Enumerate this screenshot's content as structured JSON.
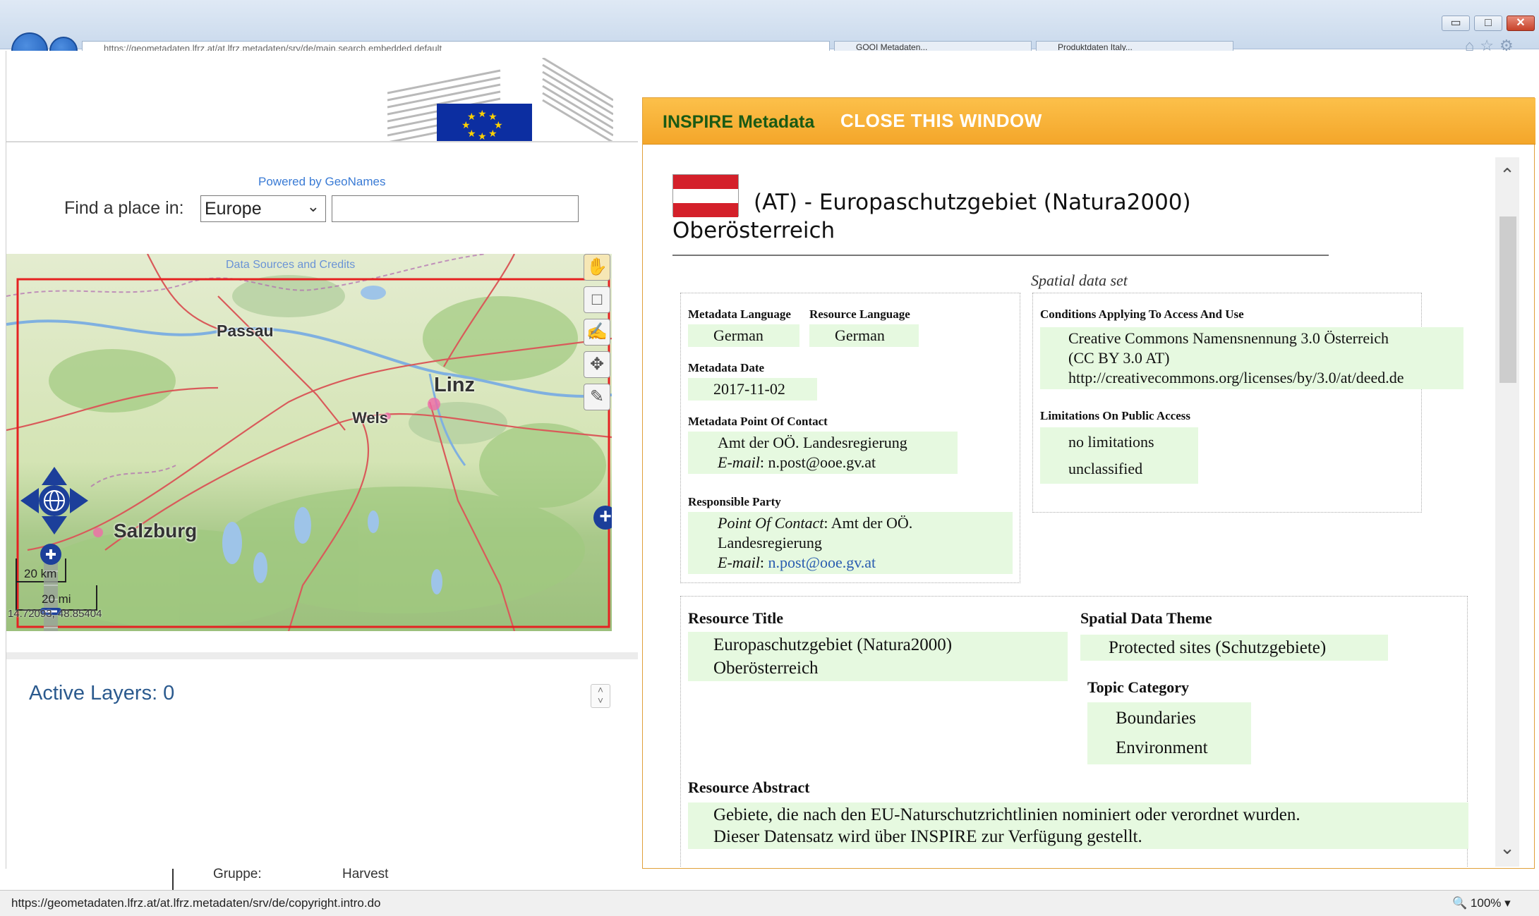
{
  "browser": {
    "back_icon": "arrow-left-icon",
    "forward_icon": "arrow-right-icon",
    "address": "https://geometadaten.lfrz.at/at.lfrz.metadaten/srv/de/main.search.embedded.default",
    "tabs": [
      "GOOI Metadaten...",
      "Produktdaten Italy..."
    ],
    "window_controls": {
      "minimize": "▭",
      "maximize": "□",
      "close": "✕"
    }
  },
  "left_panel": {
    "powered_by": "Powered by GeoNames",
    "find_label": "Find a place in:",
    "find_select_value": "Europe",
    "find_input_value": "",
    "map": {
      "credits": "Data Sources and Credits",
      "cities": [
        "Passau",
        "Linz",
        "Wels",
        "Salzburg"
      ],
      "scale_km": "20 km",
      "scale_mi": "20 mi",
      "coords": "14.72093, 48.85404",
      "colors": {
        "frame": "#e52222",
        "nav": "#1c3f9a"
      }
    },
    "active_layers": "Active Layers: 0",
    "grid": {
      "col_gruppe": "Gruppe:",
      "col_harvest": "Harvest"
    }
  },
  "popup": {
    "title": "INSPIRE Metadata",
    "close": "CLOSE THIS WINDOW",
    "flag_colors": [
      "#d4202a",
      "#ffffff",
      "#d4202a"
    ],
    "dataset_title_line1": "(AT) - Europaschutzgebiet (Natura2000)",
    "dataset_title_line2": "Oberösterreich",
    "dataset_type": "Spatial data set",
    "metadata": {
      "metadata_language_label": "Metadata Language",
      "metadata_language": "German",
      "resource_language_label": "Resource Language",
      "resource_language": "German",
      "metadata_date_label": "Metadata Date",
      "metadata_date": "2017-11-02",
      "poc_label": "Metadata Point Of Contact",
      "poc_org": "Amt der OÖ. Landesregierung",
      "email_label": "E-mail",
      "poc_email": "n.post@ooe.gv.at",
      "responsible_label": "Responsible Party",
      "rp_poc_label": "Point Of Contact",
      "rp_org_line1": "Amt der OÖ.",
      "rp_org_line2": "Landesregierung",
      "rp_email": "n.post@ooe.gv.at"
    },
    "conditions": {
      "label": "Conditions Applying To Access And Use",
      "line1": "Creative Commons Namensnennung 3.0 Österreich",
      "line2": "(CC BY 3.0 AT)",
      "line3": "http://creativecommons.org/licenses/by/3.0/at/deed.de",
      "limitations_label": "Limitations On Public Access",
      "limitation1": "no limitations",
      "limitation2": "unclassified"
    },
    "resource": {
      "title_label": "Resource Title",
      "title_line1": "Europaschutzgebiet (Natura2000)",
      "title_line2": "Oberösterreich",
      "theme_label": "Spatial Data Theme",
      "theme": "Protected sites (Schutzgebiete)",
      "topic_label": "Topic Category",
      "topic1": "Boundaries",
      "topic2": "Environment",
      "abstract_label": "Resource Abstract",
      "abstract_line1": "Gebiete, die nach den EU-Naturschutzrichtlinien nominiert oder verordnet wurden.",
      "abstract_line2": "Dieser Datensatz wird über INSPIRE zur Verfügung gestellt."
    }
  },
  "statusbar": {
    "url": "https://geometadaten.lfrz.at/at.lfrz.metadaten/srv/de/copyright.intro.do",
    "zoom": "100%"
  }
}
